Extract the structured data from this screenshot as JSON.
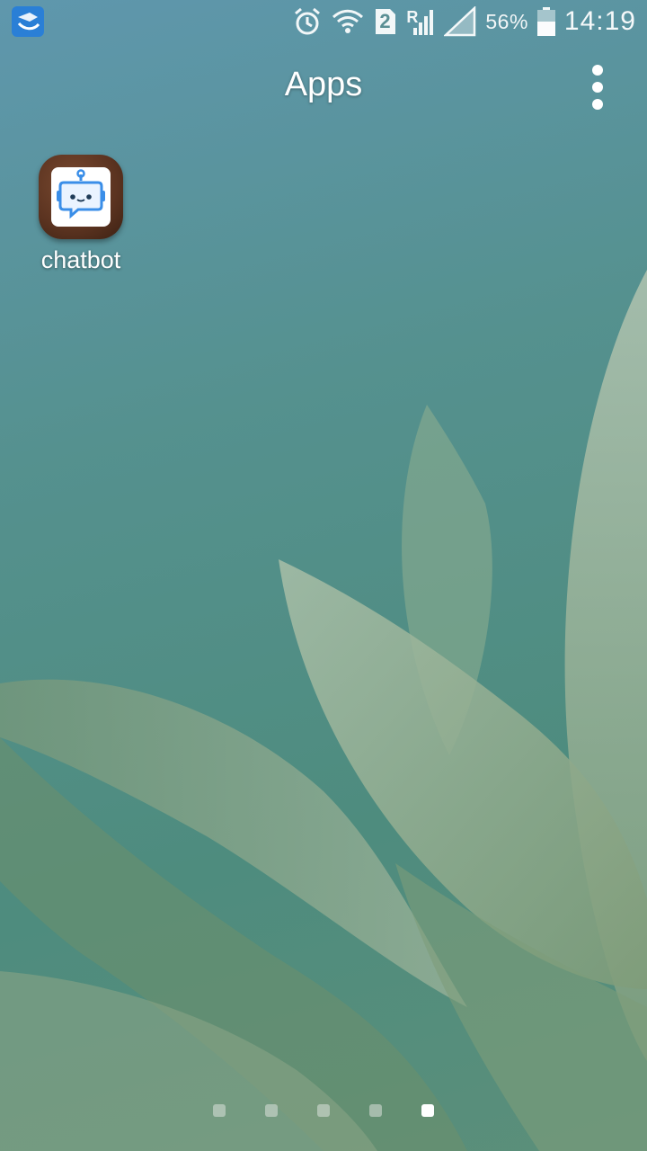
{
  "status_bar": {
    "notification_icon": "app-notification-icon",
    "icons": [
      "alarm-icon",
      "wifi-icon",
      "sim2-icon",
      "roaming-signal-icon",
      "signal-icon",
      "battery-icon"
    ],
    "sim_badge": "2",
    "roaming_letter": "R",
    "battery_percent": "56%",
    "battery_level": 0.56,
    "time": "14:19"
  },
  "header": {
    "title": "Apps",
    "menu_icon": "more-vert-icon"
  },
  "apps": [
    {
      "label": "chatbot",
      "icon": "robot-icon"
    }
  ],
  "page_indicator": {
    "count": 5,
    "active_index": 4
  }
}
